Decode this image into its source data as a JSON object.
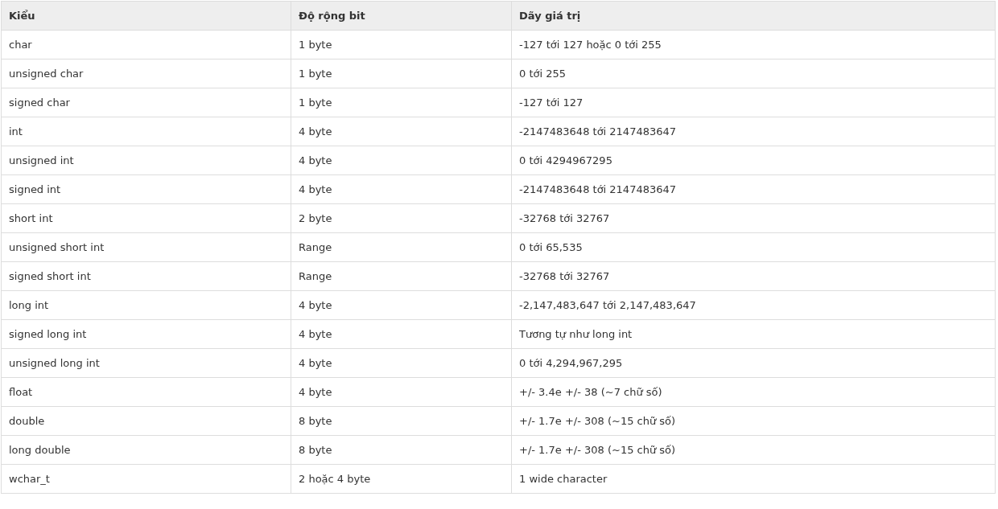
{
  "table": {
    "columns": [
      "Kiểu",
      "Độ rộng bit",
      "Dãy giá trị"
    ],
    "rows": [
      [
        "char",
        "1 byte",
        "-127 tới 127 hoặc 0 tới 255"
      ],
      [
        "unsigned char",
        "1 byte",
        "0 tới 255"
      ],
      [
        "signed char",
        "1 byte",
        "-127 tới 127"
      ],
      [
        "int",
        "4 byte",
        "-2147483648 tới 2147483647"
      ],
      [
        "unsigned int",
        "4 byte",
        "0 tới 4294967295"
      ],
      [
        "signed int",
        "4 byte",
        "-2147483648 tới 2147483647"
      ],
      [
        "short int",
        "2 byte",
        "-32768 tới 32767"
      ],
      [
        "unsigned short int",
        "Range",
        "0 tới 65,535"
      ],
      [
        "signed short int",
        "Range",
        "-32768 tới 32767"
      ],
      [
        "long int",
        "4 byte",
        "-2,147,483,647 tới 2,147,483,647"
      ],
      [
        "signed long int",
        "4 byte",
        "Tương tự như long int"
      ],
      [
        "unsigned long int",
        "4 byte",
        "0 tới 4,294,967,295"
      ],
      [
        "float",
        "4 byte",
        "+/- 3.4e +/- 38 (~7 chữ số)"
      ],
      [
        "double",
        "8 byte",
        "+/- 1.7e +/- 308 (~15 chữ số)"
      ],
      [
        "long double",
        "8 byte",
        "+/- 1.7e +/- 308 (~15 chữ số)"
      ],
      [
        "wchar_t",
        "2 hoặc 4 byte",
        "1 wide character"
      ]
    ]
  }
}
